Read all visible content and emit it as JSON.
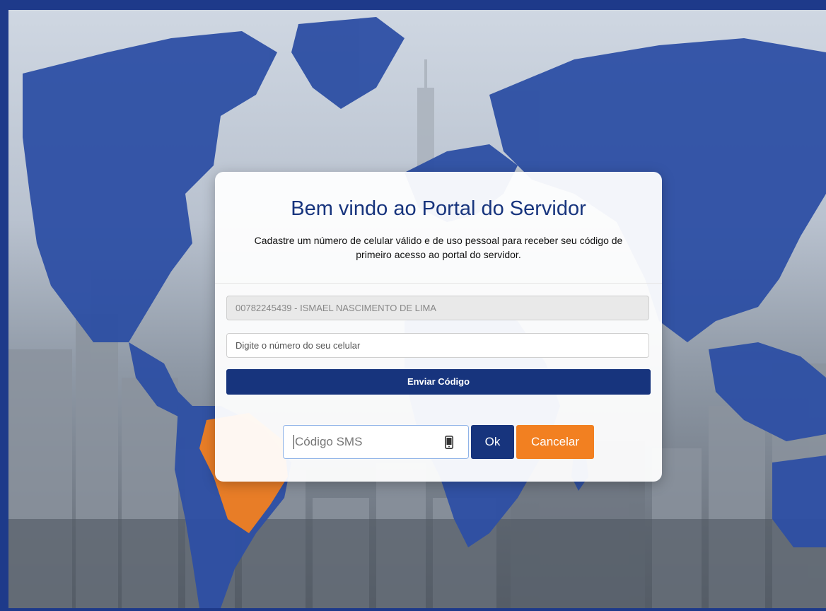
{
  "page": {
    "title": "Bem vindo ao Portal do Servidor",
    "subtitle_line1": "Cadastre um número de celular válido e de uso pessoal para receber seu código de",
    "subtitle_line2": "primeiro acesso ao portal do servidor."
  },
  "form": {
    "user_value": "00782245439 - ISMAEL NASCIMENTO DE LIMA",
    "phone_placeholder": "Digite o número do seu celular",
    "send_button": "Enviar Código",
    "sms_placeholder": "Código SMS",
    "ok_button": "Ok",
    "cancel_button": "Cancelar"
  },
  "icons": {
    "sms_field_icon": "mobile-phone-icon"
  },
  "colors": {
    "primary": "#17347d",
    "accent": "#f28021",
    "frame": "#1e3a8a"
  }
}
